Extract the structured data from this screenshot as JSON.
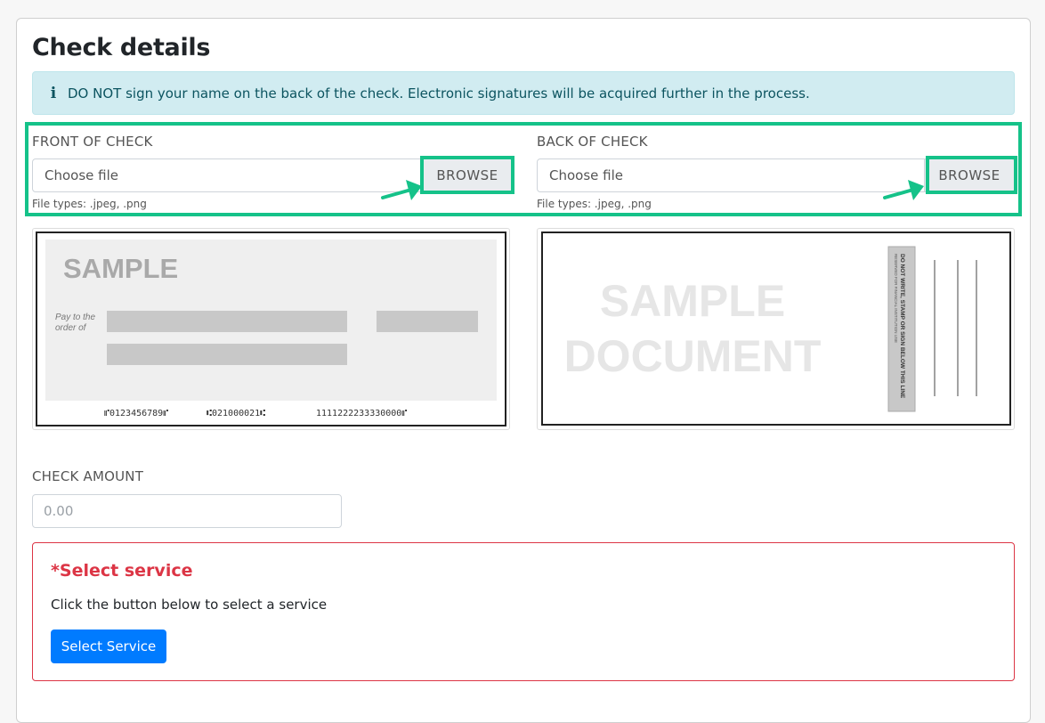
{
  "page": {
    "title": "Check details"
  },
  "alert": {
    "icon": "info-icon",
    "text": "DO NOT sign your name on the back of the check. Electronic signatures will be acquired further in the process."
  },
  "front": {
    "label": "FRONT OF CHECK",
    "file_placeholder": "Choose file",
    "browse_label": "BROWSE",
    "hint": "File types: .jpeg, .png"
  },
  "back": {
    "label": "BACK OF CHECK",
    "file_placeholder": "Choose file",
    "browse_label": "BROWSE",
    "hint": "File types: .jpeg, .png"
  },
  "sample_front": {
    "watermark": "SAMPLE",
    "pay_to": "Pay to the order of",
    "micr_routing": "⑈0123456789⑈",
    "micr_transit": "⑆021000021⑆",
    "micr_account": "1111222233330000⑈"
  },
  "sample_back": {
    "watermark_line1": "SAMPLE",
    "watermark_line2": "DOCUMENT",
    "endorse_main": "DO NOT WRITE, STAMP OR SIGN BELOW THIS LINE",
    "endorse_sub": "RESERVED FOR FINANCIAL INSTITUTION USE"
  },
  "amount": {
    "label": "CHECK AMOUNT",
    "placeholder": "0.00"
  },
  "service": {
    "title": "*Select service",
    "text": "Click the button below to select a service",
    "button_label": "Select Service"
  },
  "colors": {
    "highlight": "#15c289",
    "alert_bg": "#d1ecf1",
    "alert_text": "#0c5460",
    "danger": "#dc3545",
    "primary": "#007bff"
  }
}
